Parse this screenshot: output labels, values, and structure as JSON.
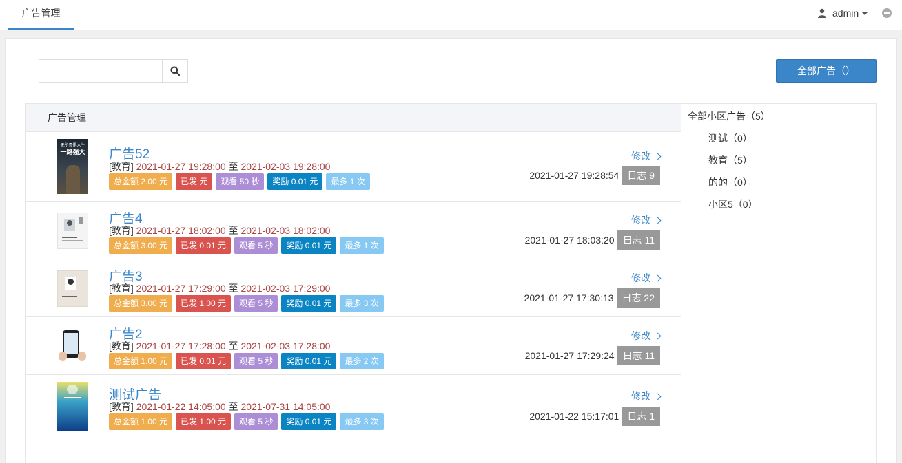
{
  "topbar": {
    "tab_label": "广告管理",
    "user_name": "admin"
  },
  "search": {
    "placeholder": ""
  },
  "all_button_label": "全部广告（）",
  "list": {
    "header": "广告管理",
    "edit_label": "修改",
    "items": [
      {
        "title": "广告52",
        "category": "[教育]",
        "start": "2021-01-27 19:28:00",
        "to": "至",
        "end": "2021-02-03 19:28:00",
        "badges": [
          "总金额 2.00 元",
          "已发 元",
          "观看 50 秒",
          "奖励 0.01 元",
          "最多 1 次"
        ],
        "created": "2021-01-27 19:28:54",
        "log": "日志 9"
      },
      {
        "title": "广告4",
        "category": "[教育]",
        "start": "2021-01-27 18:02:00",
        "to": "至",
        "end": "2021-02-03 18:02:00",
        "badges": [
          "总金额 3.00 元",
          "已发 0.01 元",
          "观看 5 秒",
          "奖励 0.01 元",
          "最多 1 次"
        ],
        "created": "2021-01-27 18:03:20",
        "log": "日志 11"
      },
      {
        "title": "广告3",
        "category": "[教育]",
        "start": "2021-01-27 17:29:00",
        "to": "至",
        "end": "2021-02-03 17:29:00",
        "badges": [
          "总金额 3.00 元",
          "已发 1.00 元",
          "观看 5 秒",
          "奖励 0.01 元",
          "最多 3 次"
        ],
        "created": "2021-01-27 17:30:13",
        "log": "日志 22"
      },
      {
        "title": "广告2",
        "category": "[教育]",
        "start": "2021-01-27 17:28:00",
        "to": "至",
        "end": "2021-02-03 17:28:00",
        "badges": [
          "总金额 1.00 元",
          "已发 0.01 元",
          "观看 5 秒",
          "奖励 0.01 元",
          "最多 2 次"
        ],
        "created": "2021-01-27 17:29:24",
        "log": "日志 11"
      },
      {
        "title": "测试广告",
        "category": "[教育]",
        "start": "2021-01-22 14:05:00",
        "to": "至",
        "end": "2021-07-31 14:05:00",
        "badges": [
          "总金额 1.00 元",
          "已发 1.00 元",
          "观看 5 秒",
          "奖励 0.01 元",
          "最多 3 次"
        ],
        "created": "2021-01-22 15:17:01",
        "log": "日志 1"
      }
    ]
  },
  "sidebar": {
    "root": "全部小区广告（5）",
    "items": [
      "测试（0）",
      "教育（5）",
      "的的（0）",
      "小区5（0）"
    ]
  },
  "thumb_text": {
    "ad52_line1": "无所畏惧人生",
    "ad52_line2": "一路强大"
  },
  "colors": {
    "accent": "#3b86c8",
    "date_red": "#a94442",
    "badge_orange": "#f0ad4e",
    "badge_red": "#d9534f",
    "badge_purple": "#ac8ed6",
    "badge_blue": "#0b84c4",
    "badge_light": "#88c9f4",
    "log_gray": "#999999"
  }
}
